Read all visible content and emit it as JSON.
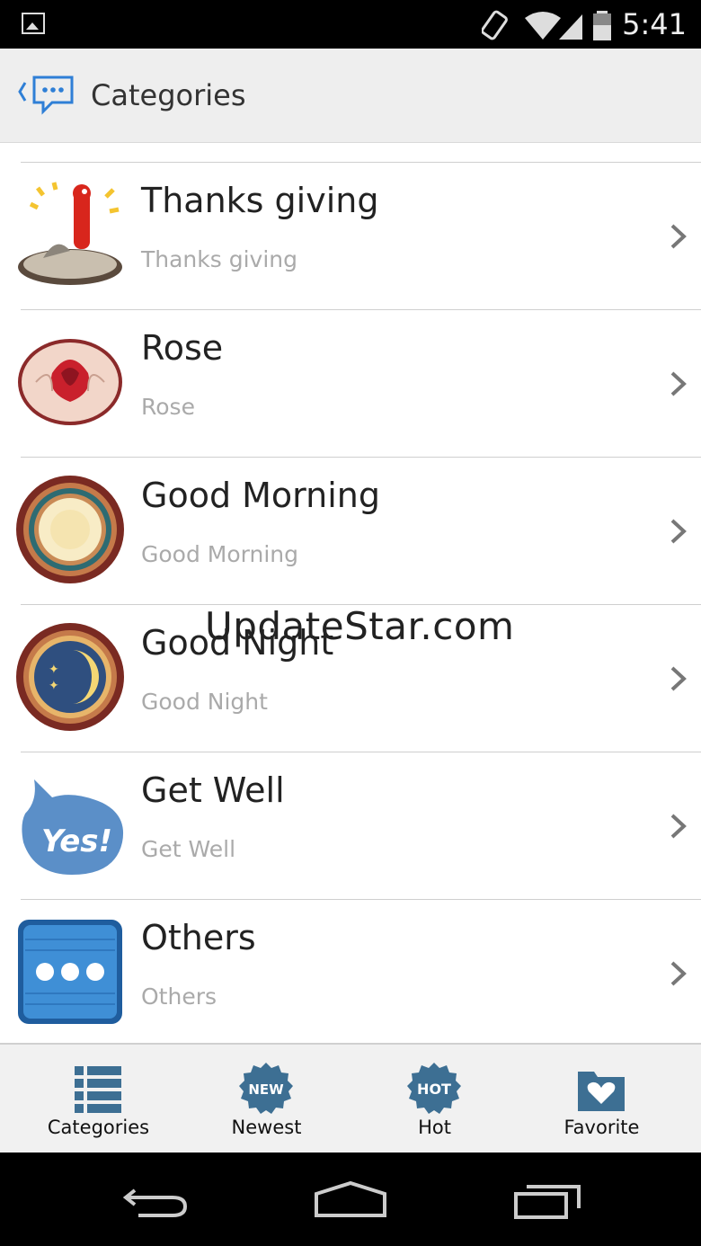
{
  "status_bar": {
    "time": "5:41"
  },
  "app_bar": {
    "title": "Categories"
  },
  "categories": [
    {
      "title": "Thanks giving",
      "subtitle": "Thanks giving",
      "icon": "turkey-icon"
    },
    {
      "title": "Rose",
      "subtitle": "Rose",
      "icon": "rose-icon"
    },
    {
      "title": "Good Morning",
      "subtitle": "Good Morning",
      "icon": "sun-badge-icon"
    },
    {
      "title": "Good Night",
      "subtitle": "Good Night",
      "icon": "moon-badge-icon"
    },
    {
      "title": "Get Well",
      "subtitle": "Get Well",
      "icon": "yes-bubble-icon",
      "icon_text": "Yes!"
    },
    {
      "title": "Others",
      "subtitle": "Others",
      "icon": "more-dots-icon"
    }
  ],
  "tabs": [
    {
      "label": "Categories",
      "icon": "list-icon"
    },
    {
      "label": "Newest",
      "icon": "new-badge-icon",
      "icon_text": "NEW"
    },
    {
      "label": "Hot",
      "icon": "hot-badge-icon",
      "icon_text": "HOT"
    },
    {
      "label": "Favorite",
      "icon": "heart-folder-icon"
    }
  ],
  "watermark": "UpdateStar.com",
  "colors": {
    "accent": "#2f7fd6",
    "tab_icon": "#3d6f93",
    "status_bar": "#000000"
  }
}
